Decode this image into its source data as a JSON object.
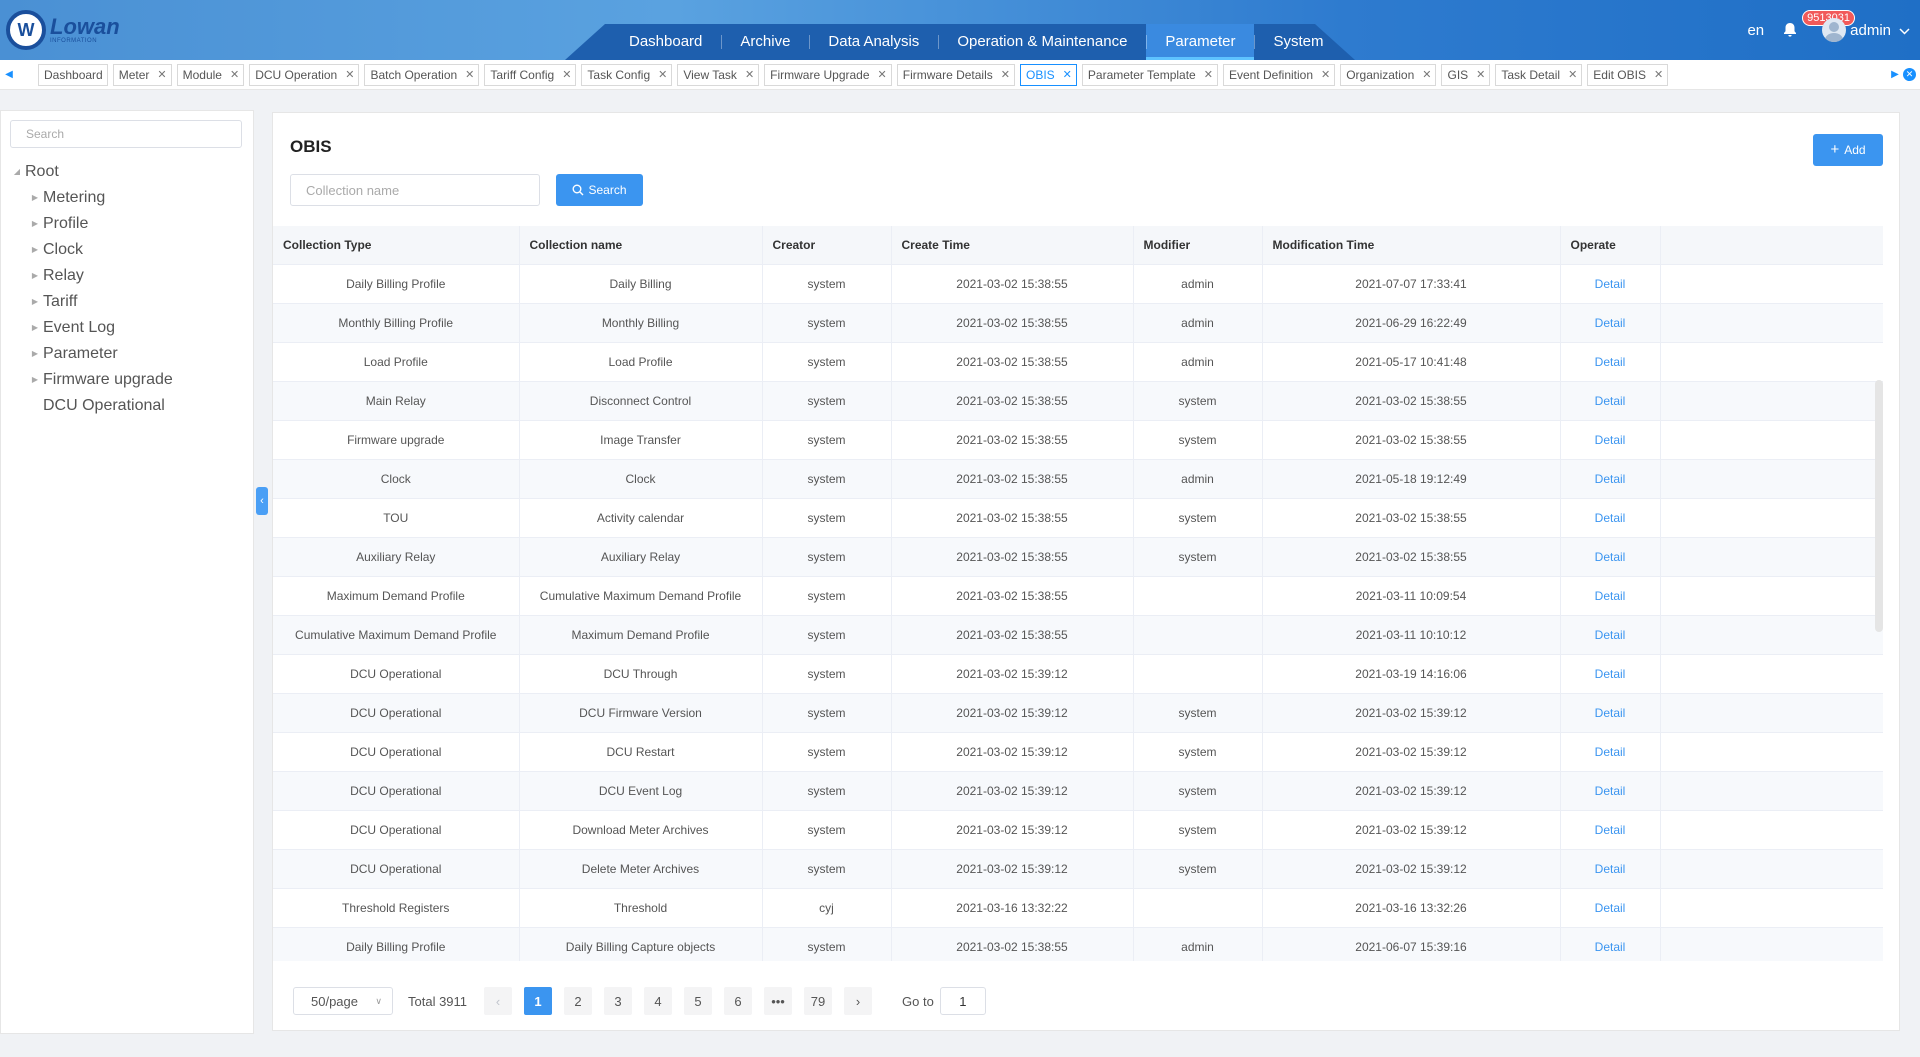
{
  "brand": {
    "mark": "W",
    "name": "Lowan",
    "sub": "INFORMATION"
  },
  "nav": [
    "Dashboard",
    "Archive",
    "Data Analysis",
    "Operation & Maintenance",
    "Parameter",
    "System"
  ],
  "nav_active": 4,
  "header": {
    "lang": "en",
    "badge": "9513031",
    "user": "admin"
  },
  "tabs": [
    "Dashboard",
    "Meter",
    "Module",
    "DCU Operation",
    "Batch Operation",
    "Tariff Config",
    "Task Config",
    "View Task",
    "Firmware Upgrade",
    "Firmware Details",
    "OBIS",
    "Parameter Template",
    "Event Definition",
    "Organization",
    "GIS",
    "Task Detail",
    "Edit OBIS"
  ],
  "tabs_closable": [
    false,
    true,
    true,
    true,
    true,
    true,
    true,
    true,
    true,
    true,
    true,
    true,
    true,
    true,
    true,
    true,
    true
  ],
  "tab_active": 10,
  "sidebar": {
    "search_placeholder": "Search",
    "root": "Root",
    "items": [
      "Metering",
      "Profile",
      "Clock",
      "Relay",
      "Tariff",
      "Event Log",
      "Parameter",
      "Firmware upgrade",
      "DCU Operational"
    ],
    "has_children": [
      true,
      true,
      true,
      true,
      true,
      true,
      true,
      true,
      false
    ]
  },
  "main": {
    "title": "OBIS",
    "add_label": "Add",
    "collection_placeholder": "Collection name",
    "search_label": "Search"
  },
  "table": {
    "columns": [
      "Collection Type",
      "Collection name",
      "Creator",
      "Create Time",
      "Modifier",
      "Modification Time",
      "Operate"
    ],
    "rows": [
      [
        "Daily Billing Profile",
        "Daily Billing",
        "system",
        "2021-03-02 15:38:55",
        "admin",
        "2021-07-07 17:33:41",
        "Detail"
      ],
      [
        "Monthly Billing Profile",
        "Monthly Billing",
        "system",
        "2021-03-02 15:38:55",
        "admin",
        "2021-06-29 16:22:49",
        "Detail"
      ],
      [
        "Load Profile",
        "Load Profile",
        "system",
        "2021-03-02 15:38:55",
        "admin",
        "2021-05-17 10:41:48",
        "Detail"
      ],
      [
        "Main Relay",
        "Disconnect Control",
        "system",
        "2021-03-02 15:38:55",
        "system",
        "2021-03-02 15:38:55",
        "Detail"
      ],
      [
        "Firmware upgrade",
        "Image Transfer",
        "system",
        "2021-03-02 15:38:55",
        "system",
        "2021-03-02 15:38:55",
        "Detail"
      ],
      [
        "Clock",
        "Clock",
        "system",
        "2021-03-02 15:38:55",
        "admin",
        "2021-05-18 19:12:49",
        "Detail"
      ],
      [
        "TOU",
        "Activity calendar",
        "system",
        "2021-03-02 15:38:55",
        "system",
        "2021-03-02 15:38:55",
        "Detail"
      ],
      [
        "Auxiliary Relay",
        "Auxiliary Relay",
        "system",
        "2021-03-02 15:38:55",
        "system",
        "2021-03-02 15:38:55",
        "Detail"
      ],
      [
        "Maximum Demand Profile",
        "Cumulative Maximum Demand Profile",
        "system",
        "2021-03-02 15:38:55",
        "",
        "2021-03-11 10:09:54",
        "Detail"
      ],
      [
        "Cumulative Maximum Demand Profile",
        "Maximum Demand Profile",
        "system",
        "2021-03-02 15:38:55",
        "",
        "2021-03-11 10:10:12",
        "Detail"
      ],
      [
        "DCU Operational",
        "DCU Through",
        "system",
        "2021-03-02 15:39:12",
        "",
        "2021-03-19 14:16:06",
        "Detail"
      ],
      [
        "DCU Operational",
        "DCU Firmware Version",
        "system",
        "2021-03-02 15:39:12",
        "system",
        "2021-03-02 15:39:12",
        "Detail"
      ],
      [
        "DCU Operational",
        "DCU Restart",
        "system",
        "2021-03-02 15:39:12",
        "system",
        "2021-03-02 15:39:12",
        "Detail"
      ],
      [
        "DCU Operational",
        "DCU Event Log",
        "system",
        "2021-03-02 15:39:12",
        "system",
        "2021-03-02 15:39:12",
        "Detail"
      ],
      [
        "DCU Operational",
        "Download Meter Archives",
        "system",
        "2021-03-02 15:39:12",
        "system",
        "2021-03-02 15:39:12",
        "Detail"
      ],
      [
        "DCU Operational",
        "Delete Meter Archives",
        "system",
        "2021-03-02 15:39:12",
        "system",
        "2021-03-02 15:39:12",
        "Detail"
      ],
      [
        "Threshold Registers",
        "Threshold",
        "cyj",
        "2021-03-16 13:32:22",
        "",
        "2021-03-16 13:32:26",
        "Detail"
      ],
      [
        "Daily Billing Profile",
        "Daily Billing Capture objects",
        "system",
        "2021-03-02 15:38:55",
        "admin",
        "2021-06-07 15:39:16",
        "Detail"
      ]
    ]
  },
  "pagination": {
    "page_size": "50/page",
    "total": "Total 3911",
    "pages": [
      "1",
      "2",
      "3",
      "4",
      "5",
      "6",
      "•••",
      "79"
    ],
    "current": 0,
    "prev": "‹",
    "next": "›",
    "goto_label": "Go to",
    "goto_value": "1"
  },
  "colors": {
    "accent": "#3b95f0",
    "header_start": "#4a90d4",
    "header_end": "#1f6fc6",
    "badge": "#f15a5a"
  }
}
